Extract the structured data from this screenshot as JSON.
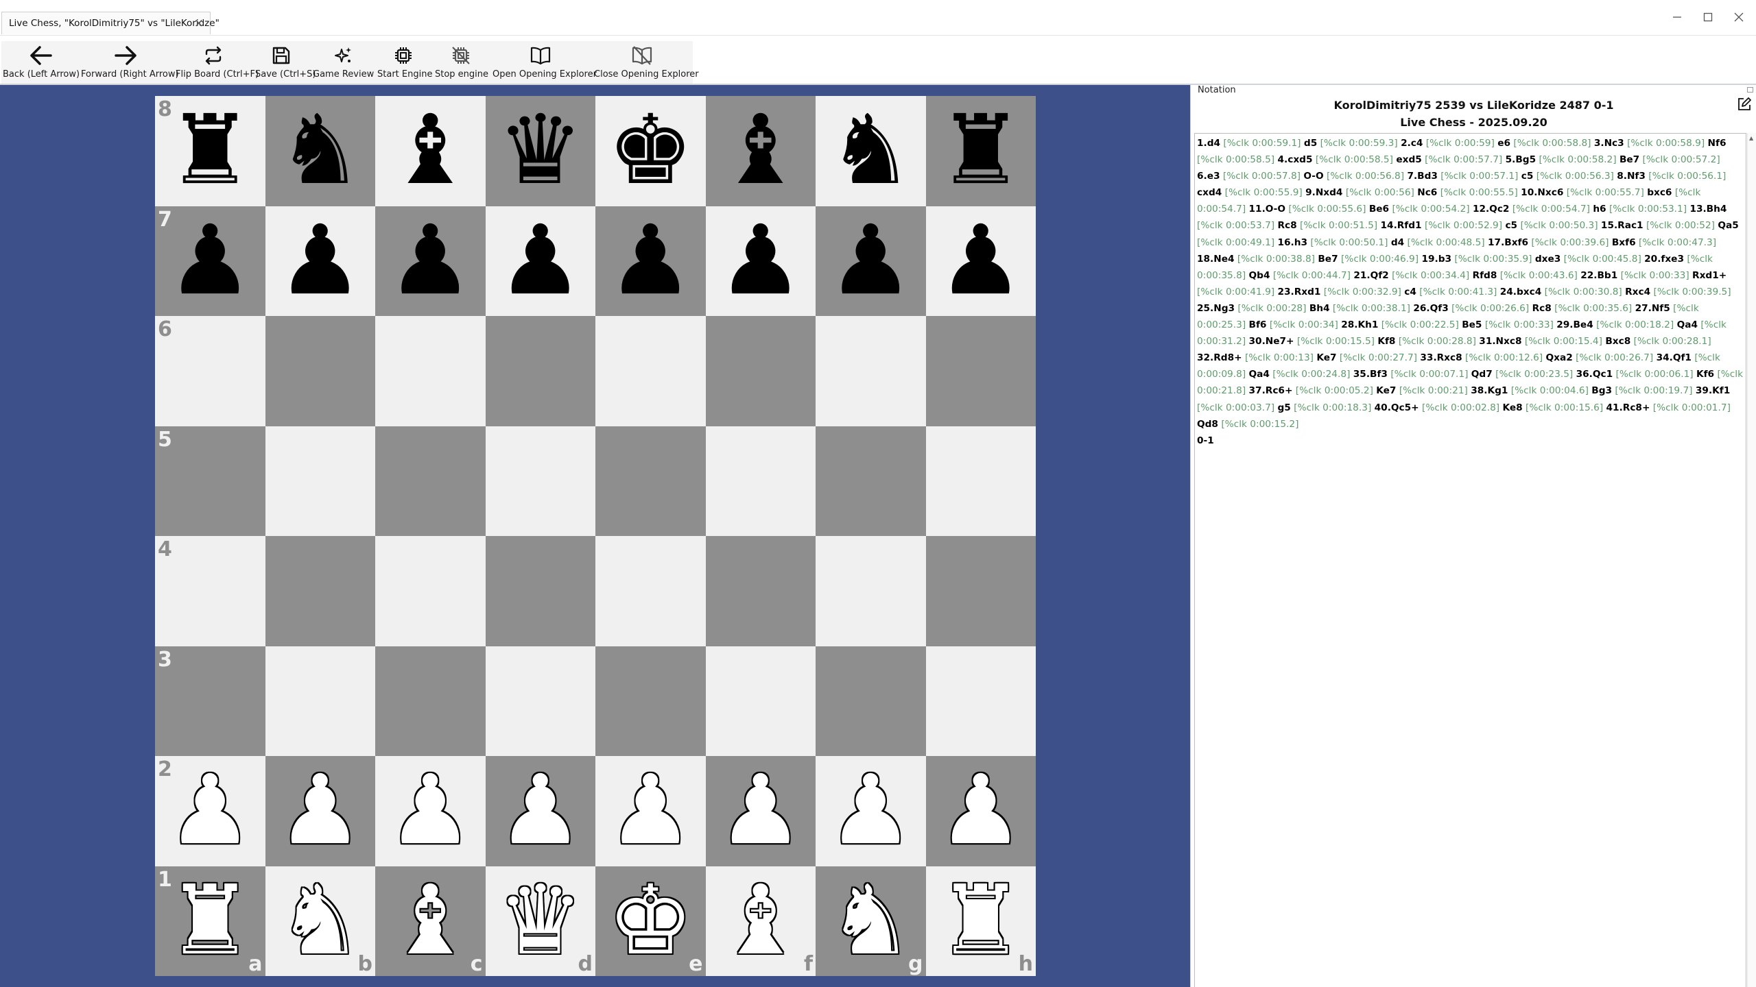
{
  "window": {
    "tab_title": "Live Chess,  \"KorolDimitriy75\" vs \"LileKoridze\"",
    "tab_close": "×",
    "minimize": "—",
    "maximize": "☐",
    "close": "✕"
  },
  "toolbar": {
    "buttons": [
      {
        "label": "Back (Left Arrow)",
        "icon": "arrow-left-icon"
      },
      {
        "label": "Forward (Right Arrow)",
        "icon": "arrow-right-icon"
      },
      {
        "label": "Flip Board (Ctrl+F)",
        "icon": "flip-icon"
      },
      {
        "label": "Save (Ctrl+S)",
        "icon": "save-icon"
      },
      {
        "label": "Game Review",
        "icon": "sparkle-icon"
      },
      {
        "label": "Start Engine",
        "icon": "chip-icon"
      },
      {
        "label": "Stop engine",
        "icon": "chip-off-icon"
      },
      {
        "label": "Open Opening Explorer",
        "icon": "book-icon"
      },
      {
        "label": "Close Opening Explorer",
        "icon": "book-off-icon"
      }
    ]
  },
  "board": {
    "light_color": "#f0f0f0",
    "dark_color": "#8e8e8e",
    "background": "#3e5089",
    "ranks": [
      "8",
      "7",
      "6",
      "5",
      "4",
      "3",
      "2",
      "1"
    ],
    "files": [
      "a",
      "b",
      "c",
      "d",
      "e",
      "f",
      "g",
      "h"
    ],
    "position": [
      [
        "r",
        "n",
        "b",
        "q",
        "k",
        "b",
        "n",
        "r"
      ],
      [
        "p",
        "p",
        "p",
        "p",
        "p",
        "p",
        "p",
        "p"
      ],
      [
        "",
        "",
        "",
        "",
        "",
        "",
        "",
        ""
      ],
      [
        "",
        "",
        "",
        "",
        "",
        "",
        "",
        ""
      ],
      [
        "",
        "",
        "",
        "",
        "",
        "",
        "",
        ""
      ],
      [
        "",
        "",
        "",
        "",
        "",
        "",
        "",
        ""
      ],
      [
        "P",
        "P",
        "P",
        "P",
        "P",
        "P",
        "P",
        "P"
      ],
      [
        "R",
        "N",
        "B",
        "Q",
        "K",
        "B",
        "N",
        "R"
      ]
    ]
  },
  "notation": {
    "title": "Notation",
    "header_line1": "KorolDimitriy75  2539  vs  LileKoridze  2487  0-1",
    "header_line2": "Live Chess  -  2025.09.20",
    "clock_color": "#5e9c6b",
    "moves": [
      [
        "1.d4",
        "[%clk 0:00:59.1]"
      ],
      [
        "d5",
        "[%clk 0:00:59.3]"
      ],
      [
        "2.c4",
        "[%clk 0:00:59]"
      ],
      [
        "e6",
        "[%clk 0:00:58.8]"
      ],
      [
        "3.Nc3",
        "[%clk 0:00:58.9]"
      ],
      [
        "Nf6",
        "[%clk 0:00:58.5]"
      ],
      [
        "4.cxd5",
        "[%clk 0:00:58.5]"
      ],
      [
        "exd5",
        "[%clk 0:00:57.7]"
      ],
      [
        "5.Bg5",
        "[%clk 0:00:58.2]"
      ],
      [
        "Be7",
        "[%clk 0:00:57.2]"
      ],
      [
        "6.e3",
        "[%clk 0:00:57.8]"
      ],
      [
        "O-O",
        "[%clk 0:00:56.8]"
      ],
      [
        "7.Bd3",
        "[%clk 0:00:57.1]"
      ],
      [
        "c5",
        "[%clk 0:00:56.3]"
      ],
      [
        "8.Nf3",
        "[%clk 0:00:56.1]"
      ],
      [
        "cxd4",
        "[%clk 0:00:55.9]"
      ],
      [
        "9.Nxd4",
        "[%clk 0:00:56]"
      ],
      [
        "Nc6",
        "[%clk 0:00:55.5]"
      ],
      [
        "10.Nxc6",
        "[%clk 0:00:55.7]"
      ],
      [
        "bxc6",
        "[%clk 0:00:54.7]"
      ],
      [
        "11.O-O",
        "[%clk 0:00:55.6]"
      ],
      [
        "Be6",
        "[%clk 0:00:54.2]"
      ],
      [
        "12.Qc2",
        "[%clk 0:00:54.7]"
      ],
      [
        "h6",
        "[%clk 0:00:53.1]"
      ],
      [
        "13.Bh4",
        "[%clk 0:00:53.7]"
      ],
      [
        "Rc8",
        "[%clk 0:00:51.5]"
      ],
      [
        "14.Rfd1",
        "[%clk 0:00:52.9]"
      ],
      [
        "c5",
        "[%clk 0:00:50.3]"
      ],
      [
        "15.Rac1",
        "[%clk 0:00:52]"
      ],
      [
        "Qa5",
        "[%clk 0:00:49.1]"
      ],
      [
        "16.h3",
        "[%clk 0:00:50.1]"
      ],
      [
        "d4",
        "[%clk 0:00:48.5]"
      ],
      [
        "17.Bxf6",
        "[%clk 0:00:39.6]"
      ],
      [
        "Bxf6",
        "[%clk 0:00:47.3]"
      ],
      [
        "18.Ne4",
        "[%clk 0:00:38.8]"
      ],
      [
        "Be7",
        "[%clk 0:00:46.9]"
      ],
      [
        "19.b3",
        "[%clk 0:00:35.9]"
      ],
      [
        "dxe3",
        "[%clk 0:00:45.8]"
      ],
      [
        "20.fxe3",
        "[%clk 0:00:35.8]"
      ],
      [
        "Qb4",
        "[%clk 0:00:44.7]"
      ],
      [
        "21.Qf2",
        "[%clk 0:00:34.4]"
      ],
      [
        "Rfd8",
        "[%clk 0:00:43.6]"
      ],
      [
        "22.Bb1",
        "[%clk 0:00:33]"
      ],
      [
        "Rxd1+",
        "[%clk 0:00:41.9]"
      ],
      [
        "23.Rxd1",
        "[%clk 0:00:32.9]"
      ],
      [
        "c4",
        "[%clk 0:00:41.3]"
      ],
      [
        "24.bxc4",
        "[%clk 0:00:30.8]"
      ],
      [
        "Rxc4",
        "[%clk 0:00:39.5]"
      ],
      [
        "25.Ng3",
        "[%clk 0:00:28]"
      ],
      [
        "Bh4",
        "[%clk 0:00:38.1]"
      ],
      [
        "26.Qf3",
        "[%clk 0:00:26.6]"
      ],
      [
        "Rc8",
        "[%clk 0:00:35.6]"
      ],
      [
        "27.Nf5",
        "[%clk 0:00:25.3]"
      ],
      [
        "Bf6",
        "[%clk 0:00:34]"
      ],
      [
        "28.Kh1",
        "[%clk 0:00:22.5]"
      ],
      [
        "Be5",
        "[%clk 0:00:33]"
      ],
      [
        "29.Be4",
        "[%clk 0:00:18.2]"
      ],
      [
        "Qa4",
        "[%clk 0:00:31.2]"
      ],
      [
        "30.Ne7+",
        "[%clk 0:00:15.5]"
      ],
      [
        "Kf8",
        "[%clk 0:00:28.8]"
      ],
      [
        "31.Nxc8",
        "[%clk 0:00:15.4]"
      ],
      [
        "Bxc8",
        "[%clk 0:00:28.1]"
      ],
      [
        "32.Rd8+",
        "[%clk 0:00:13]"
      ],
      [
        "Ke7",
        "[%clk 0:00:27.7]"
      ],
      [
        "33.Rxc8",
        "[%clk 0:00:12.6]"
      ],
      [
        "Qxa2",
        "[%clk 0:00:26.7]"
      ],
      [
        "34.Qf1",
        "[%clk 0:00:09.8]"
      ],
      [
        "Qa4",
        "[%clk 0:00:24.8]"
      ],
      [
        "35.Bf3",
        "[%clk 0:00:07.1]"
      ],
      [
        "Qd7",
        "[%clk 0:00:23.5]"
      ],
      [
        "36.Qc1",
        "[%clk 0:00:06.1]"
      ],
      [
        "Kf6",
        "[%clk 0:00:21.8]"
      ],
      [
        "37.Rc6+",
        "[%clk 0:00:05.2]"
      ],
      [
        "Ke7",
        "[%clk 0:00:21]"
      ],
      [
        "38.Kg1",
        "[%clk 0:00:04.6]"
      ],
      [
        "Bg3",
        "[%clk 0:00:19.7]"
      ],
      [
        "39.Kf1",
        "[%clk 0:00:03.7]"
      ],
      [
        "g5",
        "[%clk 0:00:18.3]"
      ],
      [
        "40.Qc5+",
        "[%clk 0:00:02.8]"
      ],
      [
        "Ke8",
        "[%clk 0:00:15.6]"
      ],
      [
        "41.Rc8+",
        "[%clk 0:00:01.7]"
      ],
      [
        "Qd8",
        "[%clk 0:00:15.2]"
      ]
    ],
    "result": "0-1"
  }
}
